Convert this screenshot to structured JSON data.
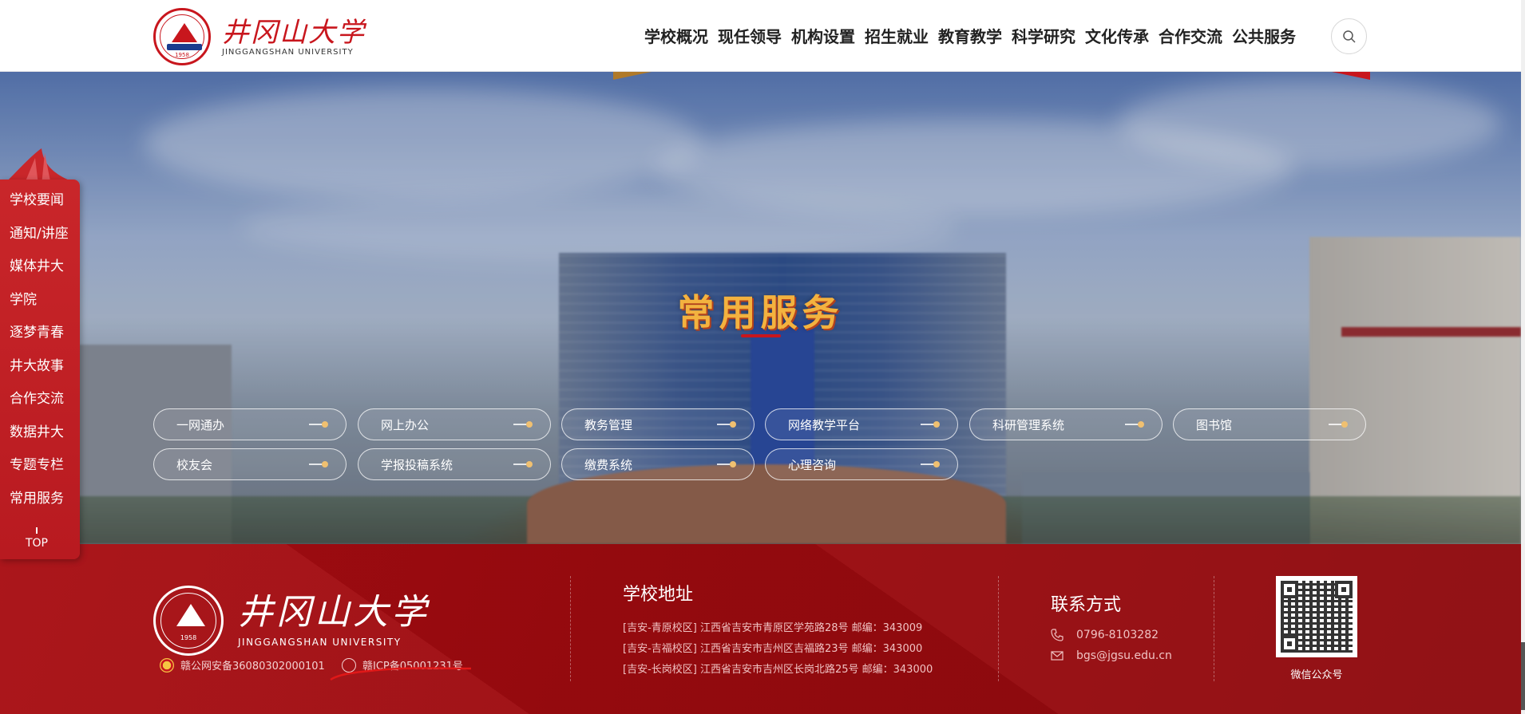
{
  "header": {
    "logo_cn": "井冈山大学",
    "logo_en": "JINGGANGSHAN UNIVERSITY",
    "logo_year": "1958",
    "nav": [
      "学校概况",
      "现任领导",
      "机构设置",
      "招生就业",
      "教育教学",
      "科学研究",
      "文化传承",
      "合作交流",
      "公共服务"
    ],
    "search_icon": "search-icon"
  },
  "sidebar": {
    "items": [
      "学校要闻",
      "通知/讲座",
      "媒体井大",
      "学院",
      "逐梦青春",
      "井大故事",
      "合作交流",
      "数据井大",
      "专题专栏",
      "常用服务"
    ],
    "top_label": "TOP"
  },
  "services": {
    "title": "常用服务",
    "items": [
      "一网通办",
      "网上办公",
      "教务管理",
      "网络教学平台",
      "科研管理系统",
      "图书馆",
      "校友会",
      "学报投稿系统",
      "缴费系统",
      "心理咨询"
    ]
  },
  "footer": {
    "police_reg": "赣公网安备36080302000101",
    "icp_reg": "赣ICP备05001231号",
    "address_title": "学校地址",
    "addresses": [
      "[吉安-青原校区] 江西省吉安市青原区学苑路28号 邮编：343009",
      "[吉安-吉福校区] 江西省吉安市吉州区吉福路23号 邮编：343000",
      "[吉安-长岗校区] 江西省吉安市吉州区长岗北路25号 邮编：343000"
    ],
    "contact_title": "联系方式",
    "phone": "0796-8103282",
    "email": "bgs@jgsu.edu.cn",
    "wechat_caption": "微信公众号"
  },
  "colors": {
    "brand_red": "#c8161d",
    "footer_red": "#9c0a0f",
    "title_gold": "#f3b23f"
  }
}
